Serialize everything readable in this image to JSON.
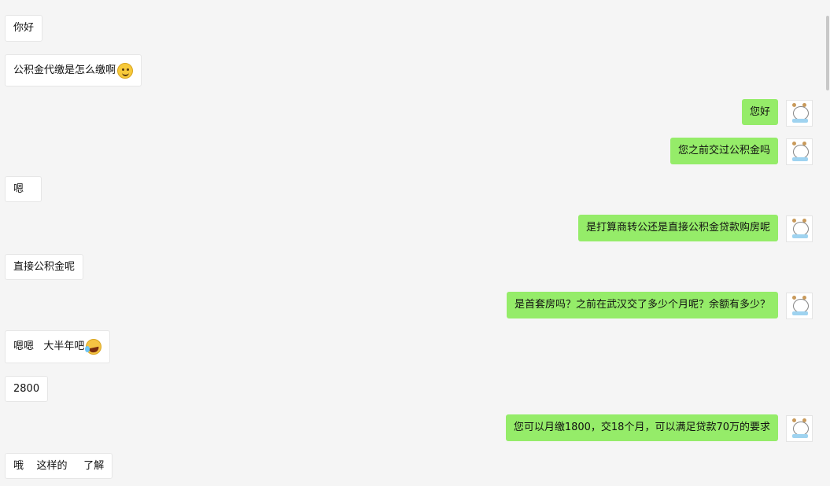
{
  "messages": [
    {
      "side": "in",
      "text": "你好"
    },
    {
      "side": "in",
      "text": "公积金代缴是怎么缴啊",
      "emoji": "smile-emoji"
    },
    {
      "side": "out",
      "text": "您好"
    },
    {
      "side": "out",
      "text": "您之前交过公积金吗"
    },
    {
      "side": "in",
      "text": "嗯"
    },
    {
      "side": "out",
      "text": "是打算商转公还是直接公积金贷款购房呢"
    },
    {
      "side": "in",
      "text": "直接公积金呢"
    },
    {
      "side": "out",
      "text": "是首套房吗？之前在武汉交了多少个月呢？余额有多少？"
    },
    {
      "side": "in",
      "text": "嗯嗯   大半年吧",
      "emoji": "laughing-emoji"
    },
    {
      "side": "in",
      "text": "2800"
    },
    {
      "side": "out",
      "text": "您可以月缴1800，交18个月，可以满足贷款70万的要求"
    },
    {
      "side": "in",
      "text": "哦    这样的     了解"
    }
  ],
  "colors": {
    "background": "#f5f5f5",
    "incoming_bubble": "#ffffff",
    "outgoing_bubble": "#95ec69"
  },
  "icons": {
    "avatar": "cartoon-avatar-icon"
  }
}
